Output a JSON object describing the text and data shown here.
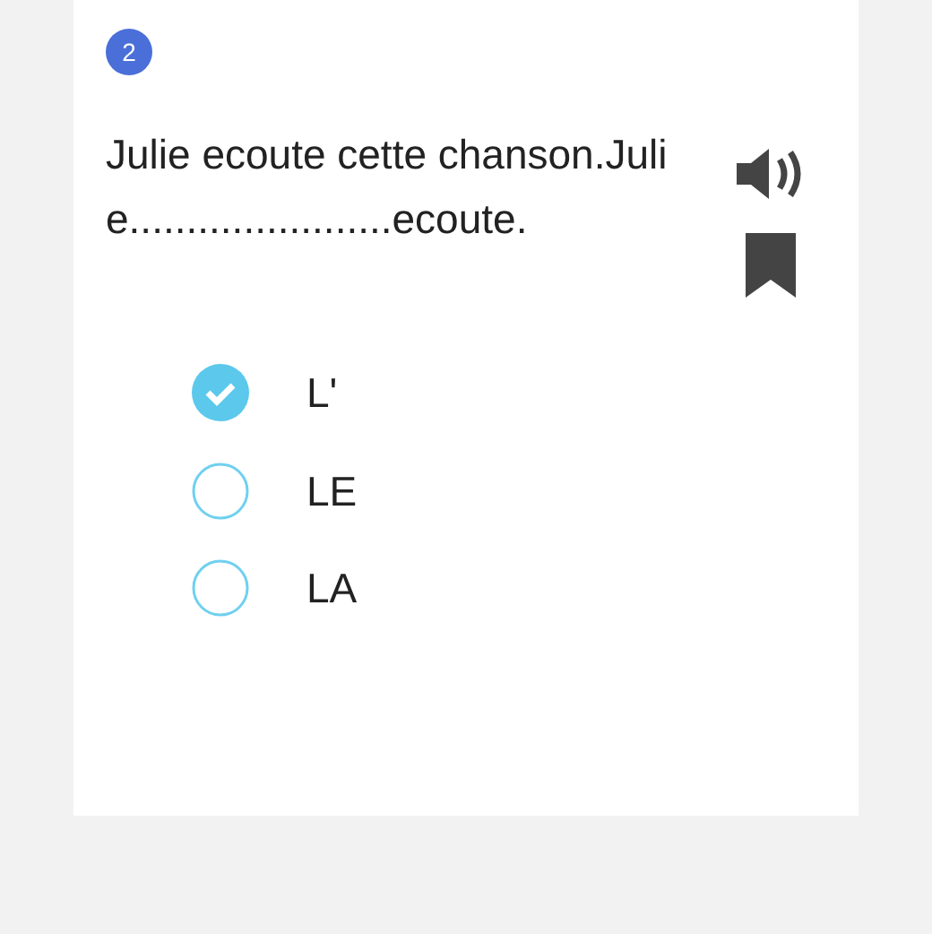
{
  "question": {
    "number": "2",
    "text": "Julie ecoute cette chanson.Julie.......................ecoute."
  },
  "options": [
    {
      "label": "L'",
      "selected": true
    },
    {
      "label": "LE",
      "selected": false
    },
    {
      "label": "LA",
      "selected": false
    }
  ]
}
